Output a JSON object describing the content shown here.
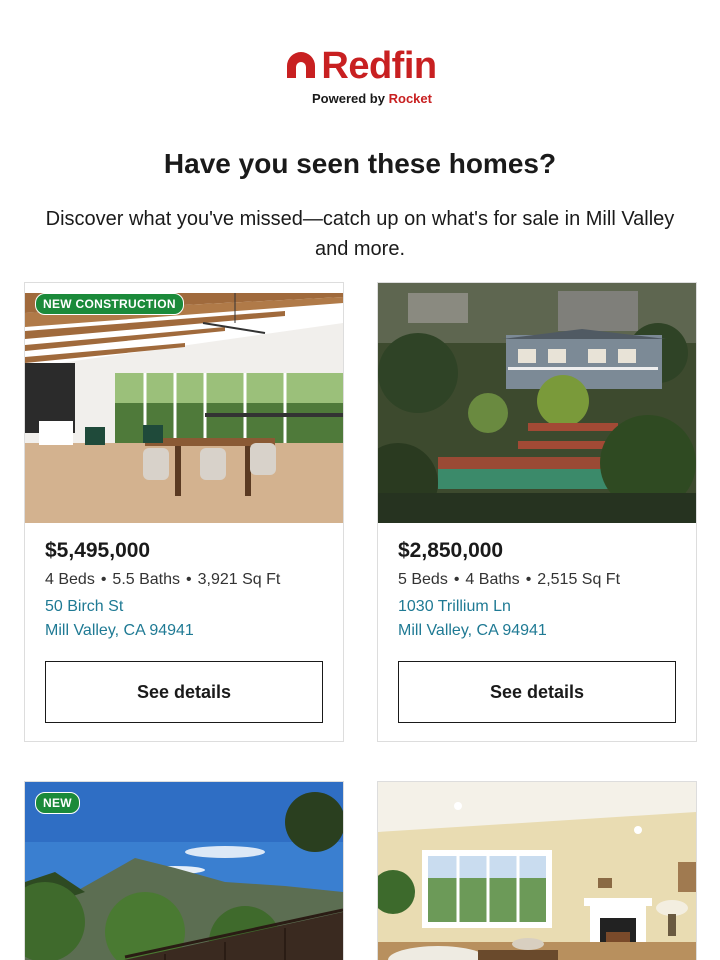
{
  "brand": {
    "name": "Redfin",
    "tagline_prefix": "Powered by",
    "tagline_brand": "Rocket",
    "color": "#c82021"
  },
  "headline": "Have you seen these homes?",
  "subtext": "Discover what you've missed—catch up on what's for sale in Mill Valley and more.",
  "accent_link_color": "#1f7a94",
  "badge_color": "#1b8a3a",
  "listings": [
    {
      "badge": "NEW CONSTRUCTION",
      "price": "$5,495,000",
      "beds": "4 Beds",
      "baths": "5.5 Baths",
      "sqft": "3,921 Sq Ft",
      "street": "50 Birch St",
      "city": "Mill Valley, CA 94941",
      "button": "See details",
      "photo_icon": "interior-dining-room-photo"
    },
    {
      "badge": "",
      "price": "$2,850,000",
      "beds": "5 Beds",
      "baths": "4 Baths",
      "sqft": "2,515 Sq Ft",
      "street": "1030 Trillium Ln",
      "city": "Mill Valley, CA 94941",
      "button": "See details",
      "photo_icon": "hillside-house-photo"
    },
    {
      "badge": "NEW",
      "photo_icon": "mountain-view-deck-photo"
    },
    {
      "badge": "",
      "photo_icon": "living-room-fireplace-photo"
    }
  ]
}
